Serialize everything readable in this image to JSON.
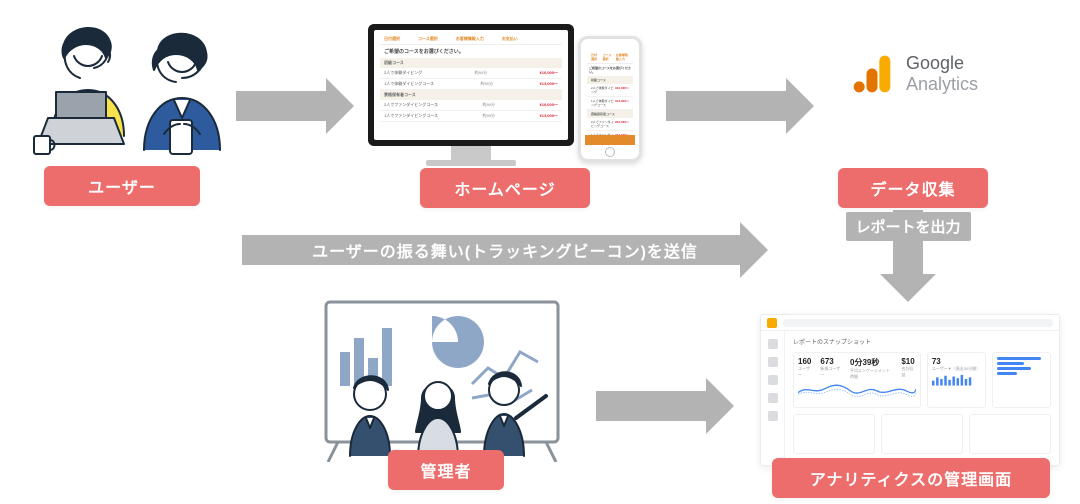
{
  "labels": {
    "user": "ユーザー",
    "homepage": "ホームページ",
    "data_collection": "データ収集",
    "admin": "管理者",
    "analytics_screen": "アナリティクスの管理画面"
  },
  "arrows": {
    "tracking_text": "ユーザーの振る舞い(トラッキングビーコン)を送信",
    "report_text": "レポートを出力"
  },
  "ga": {
    "line1": "Google",
    "line2": "Analytics"
  },
  "homepage_screen": {
    "heading": "ご希望のコースをお選びください。",
    "tabs": [
      "日付選択",
      "コース選択",
      "お客様情報入力",
      "お支払い"
    ],
    "sections": [
      {
        "title": "初級コース",
        "items": [
          {
            "name": "2人で体験ダイビング",
            "dur": "約90分",
            "price": "¥10,000〜"
          },
          {
            "name": "1人で体験ダイビングコース",
            "dur": "約90分",
            "price": "¥13,000〜"
          }
        ]
      },
      {
        "title": "資格保有者コース",
        "items": [
          {
            "name": "2人でファンダイビングコース",
            "dur": "約90分",
            "price": "¥10,000〜"
          },
          {
            "name": "1人でファンダイビングコース",
            "dur": "約90分",
            "price": "¥13,000〜"
          }
        ]
      }
    ]
  },
  "dashboard": {
    "title": "レポートのスナップショット",
    "kpis": [
      {
        "label": "ユーザー",
        "value": "160"
      },
      {
        "label": "新規ユーザー",
        "value": "673"
      },
      {
        "label": "平均エンゲージメント時間",
        "value": "0分39秒"
      },
      {
        "label": "合計収益",
        "value": "$10"
      },
      {
        "label": "ユーザー▼（過去30分間）",
        "value": "73"
      }
    ]
  },
  "colors": {
    "pill": "#EC6D6B",
    "arrow": "#B3B3B3",
    "ga_orange": "#F9AB00",
    "ga_yellow": "#E37400",
    "chart_blue": "#4285F4"
  }
}
